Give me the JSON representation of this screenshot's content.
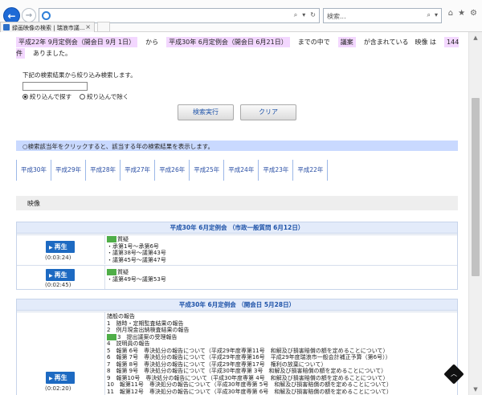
{
  "browser": {
    "search_placeholder": "検索...",
    "tab_title": "録画映像の検索 | 瑞浪市議...",
    "tab_close": "×",
    "address_ctrls": [
      "⌕",
      "▾",
      "↻"
    ]
  },
  "summary": {
    "range_from": "平成22年 9月定例会（開会日 9月 1日）",
    "from_word": "から",
    "range_to": "平成30年 6月定例会（開会日 6月21日）",
    "mid": "までの中で",
    "keyword": "議案",
    "contains": "が含まれている　映像 は",
    "count": "144件",
    "tail": "ありました。"
  },
  "filter": {
    "label": "下記の検索結果から絞り込み検索します。",
    "radio_include": "絞り込んで探す",
    "radio_exclude": "絞り込んで除く"
  },
  "buttons": {
    "search": "検索実行",
    "clear": "クリア"
  },
  "hint": "○検索該当年をクリックすると、該当する年の検索結果を表示します。",
  "years": [
    "平成30年",
    "平成29年",
    "平成28年",
    "平成27年",
    "平成26年",
    "平成25年",
    "平成24年",
    "平成23年",
    "平成22年"
  ],
  "section_label": "映像",
  "sessions": [
    {
      "title": "平成30年 6月定例会 （市政一般質問 6月12日）",
      "rows": [
        {
          "play": "再生",
          "duration": "(0:03:24)",
          "items": [
            "質疑",
            "・承第1号～承第6号",
            "・議第38号～議第43号",
            "・議第45号～議第47号"
          ]
        },
        {
          "play": "再生",
          "duration": "(0:02:45)",
          "items": [
            "質疑",
            "・議第49号～議第53号"
          ]
        }
      ]
    },
    {
      "title": "平成30年 6月定例会 （開会日 5月28日）",
      "rows": [
        {
          "play": "再生",
          "duration": "(0:02:20)",
          "items": [
            "諸般の報告",
            "1　随時・定期監査結果の報告",
            "2　例月現金出納検査結果の報告",
            "3　提出議案の受理報告",
            "4　説明員の報告",
            "5　報第 6号　専決処分の報告について（平成29年度専第11号　和解及び損害賠償の額を定めることについて）",
            "6　報第 7号　専決処分の報告について（平成29年度専第16号　平成29年度瑞浪市一般会計補正予算（第6号））",
            "7　報第 8号　専決処分の報告について（平成29年度専第17号　権利の放棄について）",
            "8　報第 9号　専決処分の報告について（平成30年度専第 3号　和解及び損害賠償の額を定めることについて）",
            "9　報第10号　専決処分の報告について（平成30年度専第 4号　和解及び損害賠償の額を定めることについて）",
            "10　報第11号　専決処分の報告について（平成30年度専第 5号　和解及び損害賠償の額を定めることについて）",
            "11　報第12号　専決処分の報告について（平成30年度専第 6号　和解及び損害賠償の額を定めることについて）"
          ]
        }
      ]
    }
  ],
  "colors": {
    "accent": "#1d6ac2",
    "highlight": "#f3d7ff",
    "hint_bg": "#c9d9ff",
    "tag": "#4fae48"
  }
}
